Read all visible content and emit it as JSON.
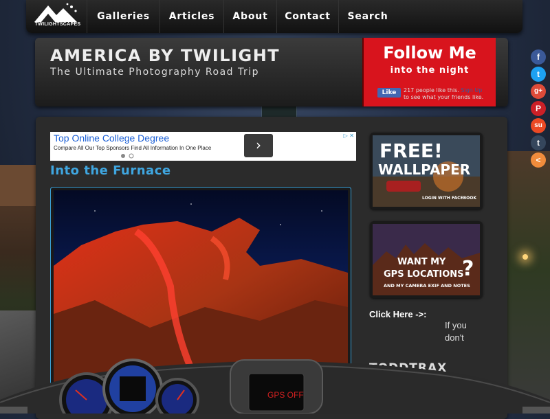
{
  "logo": {
    "text": "TWILIGHTSCAPES"
  },
  "nav": {
    "items": [
      "Galleries",
      "Articles",
      "About",
      "Contact",
      "Search"
    ]
  },
  "header": {
    "title": "AMERICA BY TWILIGHT",
    "subtitle": "The Ultimate Photography Road Trip",
    "follow_line1": "Follow Me",
    "follow_line2": "into the night",
    "fb_like": "Like",
    "fb_text": "217 people like this.",
    "fb_signup": "Sign Up",
    "fb_text_end": "to see what your friends like."
  },
  "social": {
    "icons": [
      {
        "name": "facebook-icon",
        "glyph": "f",
        "color": "#3b5998"
      },
      {
        "name": "twitter-icon",
        "glyph": "t",
        "color": "#1da1f2"
      },
      {
        "name": "google-plus-icon",
        "glyph": "g+",
        "color": "#dd4b39"
      },
      {
        "name": "pinterest-icon",
        "glyph": "P",
        "color": "#cb2027"
      },
      {
        "name": "stumbleupon-icon",
        "glyph": "su",
        "color": "#eb4924"
      },
      {
        "name": "tumblr-icon",
        "glyph": "t",
        "color": "#35465c"
      },
      {
        "name": "share-icon",
        "glyph": "<",
        "color": "#f08c3c"
      }
    ]
  },
  "ad": {
    "title": "Top Online College Degree",
    "description": "Compare All Our Top Sponsors Find All Information In One Place",
    "arrow": "›",
    "choices": "▷ ✕"
  },
  "post": {
    "title": "Into the Furnace"
  },
  "promo1": {
    "line1": "FREE!",
    "line2": "WALLPAPER",
    "small": "LOGIN WITH FACEBOOK"
  },
  "promo2": {
    "line1": "WANT MY",
    "line2": "GPS LOCATIONS",
    "small": "AND MY CAMERA EXIF AND NOTES",
    "q": "?"
  },
  "sidebar": {
    "click_here": "Click Here ->:",
    "if_you": "If you don't",
    "toddtrax": "TODDTRAX"
  },
  "dashboard": {
    "gps": "GPS OFF"
  }
}
